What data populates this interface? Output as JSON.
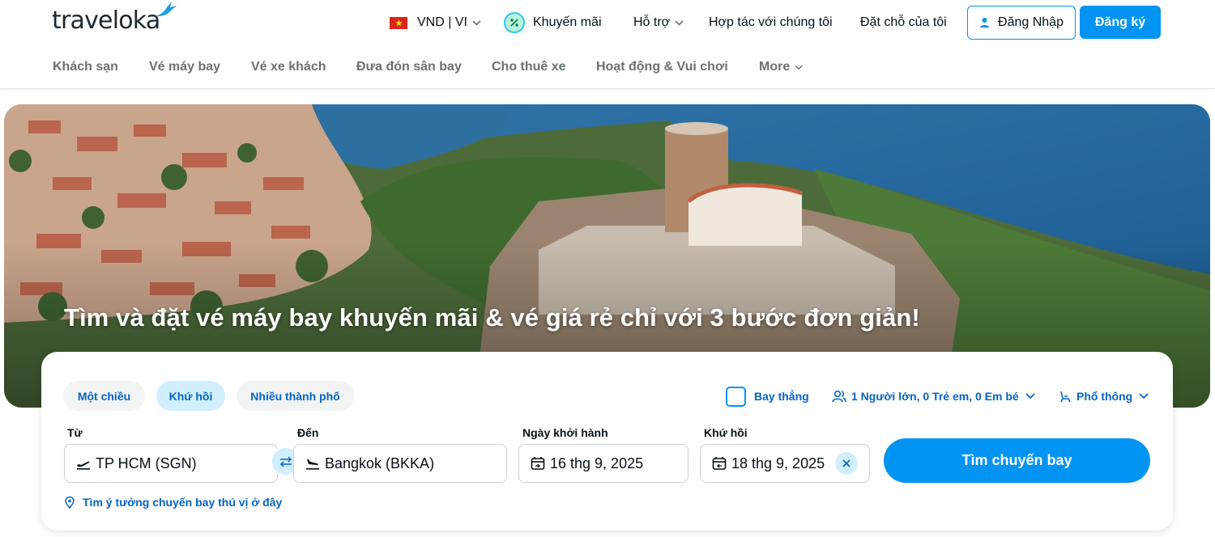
{
  "brand": {
    "logo_text": "traveloka",
    "accent": "#0194f3",
    "link_color": "#0264c8"
  },
  "header": {
    "currency_lang": "VND | VI",
    "promotions": "Khuyến mãi",
    "support": "Hỗ trợ",
    "partner": "Hợp tác với chúng tôi",
    "my_bookings": "Đặt chỗ của tôi",
    "login": "Đăng Nhập",
    "register": "Đăng ký"
  },
  "nav": {
    "items": [
      "Khách sạn",
      "Vé máy bay",
      "Vé xe khách",
      "Đưa đón sân bay",
      "Cho thuê xe",
      "Hoạt động & Vui chơi"
    ],
    "more": "More"
  },
  "hero": {
    "title": "Tìm và đặt vé máy bay khuyến mãi & vé giá rẻ chỉ với 3 bước đơn giản!"
  },
  "search": {
    "trip_types": [
      "Một chiều",
      "Khứ hồi",
      "Nhiều thành phố"
    ],
    "active_trip_type": "Khứ hồi",
    "direct_flight": {
      "label": "Bay thẳng",
      "checked": false
    },
    "passengers": "1 Người lớn, 0 Trẻ em, 0 Em bé",
    "seat_class": "Phổ thông",
    "from": {
      "label": "Từ",
      "value": "TP HCM (SGN)"
    },
    "to": {
      "label": "Đến",
      "value": "Bangkok (BKKA)"
    },
    "depart": {
      "label": "Ngày khởi hành",
      "value": "16 thg 9, 2025"
    },
    "return": {
      "label": "Khứ hồi",
      "value": "18 thg 9, 2025"
    },
    "submit": "Tìm chuyến bay",
    "ideas_link": "Tìm ý tưởng chuyến bay thú vị ở đây"
  }
}
